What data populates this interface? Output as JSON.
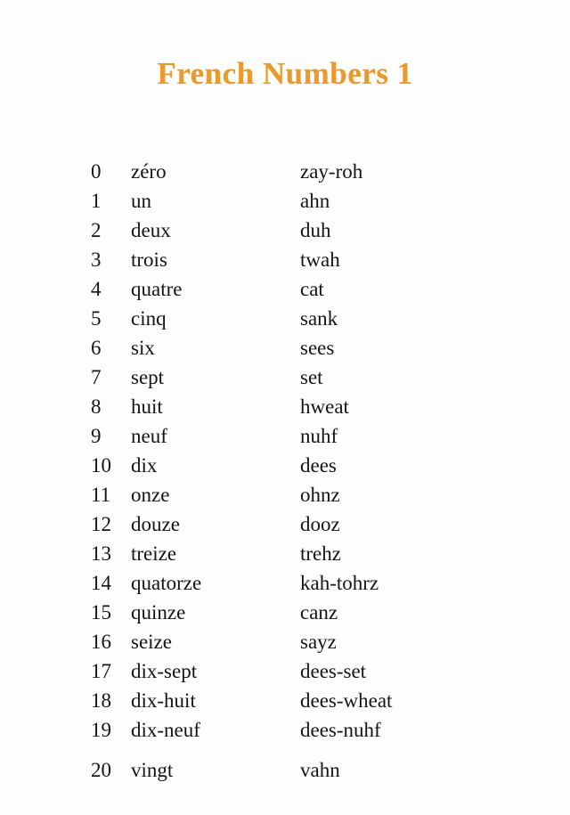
{
  "document": {
    "title": "French Numbers 1",
    "title_color": "#e79a2e",
    "text_color": "#151515",
    "background_color": "#fdfdfc"
  },
  "table": {
    "columns": [
      "number",
      "french",
      "pronunciation"
    ],
    "rows": [
      {
        "number": "0",
        "french": "zéro",
        "pronunciation": "zay-roh"
      },
      {
        "number": "1",
        "french": "un",
        "pronunciation": "ahn"
      },
      {
        "number": "2",
        "french": "deux",
        "pronunciation": "duh"
      },
      {
        "number": "3",
        "french": "trois",
        "pronunciation": "twah"
      },
      {
        "number": "4",
        "french": "quatre",
        "pronunciation": "cat"
      },
      {
        "number": "5",
        "french": "cinq",
        "pronunciation": "sank"
      },
      {
        "number": "6",
        "french": "six",
        "pronunciation": "sees"
      },
      {
        "number": "7",
        "french": "sept",
        "pronunciation": "set"
      },
      {
        "number": "8",
        "french": "huit",
        "pronunciation": "hweat"
      },
      {
        "number": "9",
        "french": "neuf",
        "pronunciation": "nuhf"
      },
      {
        "number": "10",
        "french": "dix",
        "pronunciation": "dees"
      },
      {
        "number": "11",
        "french": "onze",
        "pronunciation": "ohnz"
      },
      {
        "number": "12",
        "french": "douze",
        "pronunciation": "dooz"
      },
      {
        "number": "13",
        "french": "treize",
        "pronunciation": "trehz"
      },
      {
        "number": "14",
        "french": "quatorze",
        "pronunciation": "kah-tohrz"
      },
      {
        "number": "15",
        "french": "quinze",
        "pronunciation": "canz"
      },
      {
        "number": "16",
        "french": "seize",
        "pronunciation": "sayz"
      },
      {
        "number": "17",
        "french": "dix-sept",
        "pronunciation": "dees-set"
      },
      {
        "number": "18",
        "french": "dix-huit",
        "pronunciation": "dees-wheat"
      },
      {
        "number": "19",
        "french": "dix-neuf",
        "pronunciation": "dees-nuhf"
      },
      {
        "number": "20",
        "french": "vingt",
        "pronunciation": "vahn"
      }
    ]
  }
}
